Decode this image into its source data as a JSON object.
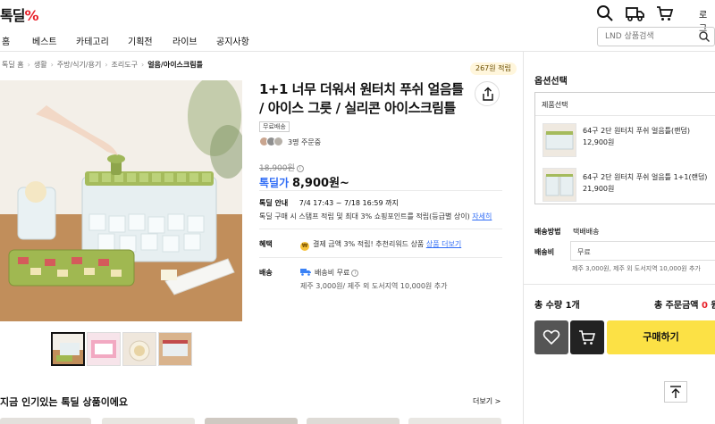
{
  "header": {
    "logo_text": "톡딜",
    "logo_mark": "%",
    "login_label": "로그",
    "icons": [
      "search-icon",
      "truck-icon",
      "cart-icon"
    ]
  },
  "nav": {
    "items": [
      "홈",
      "베스트",
      "카테고리",
      "기획전",
      "라이브",
      "공지사항"
    ],
    "search_placeholder": "LND 상품검색"
  },
  "breadcrumb": {
    "items": [
      "톡딜 홈",
      "생활",
      "주방/식기/용기",
      "조리도구"
    ],
    "current": "얼음/아이스크림틀"
  },
  "earn_badge": "267원 적립",
  "product": {
    "title": "1+1 너무 더워서 원터치 푸쉬 얼음틀 / 아이스 그릇 / 실리콘 아이스크림틀",
    "free_shipping_tag": "무료배송",
    "orders": "3명 주문중",
    "original_price": "18,900원",
    "price_label": "톡딜가",
    "price": "8,900원~",
    "deal_label": "톡딜 안내",
    "deal_period": "7/4 17:43 ~ 7/18 16:59 까지",
    "deal_desc": "톡딜 구매 시 스탬프 적립 및 최대 3% 쇼핑포인트를 적립(등급별 상이)",
    "deal_desc_link": "자세히",
    "benefit_label": "혜택",
    "benefit_coin": "₩",
    "benefit_text": "결제 금액 3% 적립! 추천리워드 상품",
    "benefit_link": "상품 더보기",
    "shipping_label": "배송",
    "shipping_fee": "배송비 무료",
    "shipping_note": "제주 3,000원/ 제주 외 도서지역 10,000원 추가"
  },
  "recommend": {
    "title": "지금 인기있는 톡딜 상품이에요",
    "more": "더보기 >"
  },
  "options": {
    "title": "옵션선택",
    "header": "제품선택",
    "items": [
      {
        "name": "64구 2단 원터치 푸쉬 얼음틀(랜덤)",
        "price": "12,900원"
      },
      {
        "name": "64구 2단 원터치 푸쉬 얼음틀 1+1(랜덤)",
        "price": "21,900원"
      }
    ],
    "ship_method_label": "배송방법",
    "ship_method": "택배배송",
    "ship_fee_label": "배송비",
    "ship_fee": "무료",
    "ship_fee_note": "제주 3,000원, 제주 외 도서지역 10,000원 추가",
    "total_qty": "총 수량 1개",
    "total_amount_label": "총 주문금액",
    "total_amount_value": "0",
    "total_amount_unit": "원",
    "buy_label": "구매하기"
  },
  "colors": {
    "accent_blue": "#2f6cf6",
    "logo_red": "#e8212a",
    "buy_yellow": "#fce145"
  }
}
